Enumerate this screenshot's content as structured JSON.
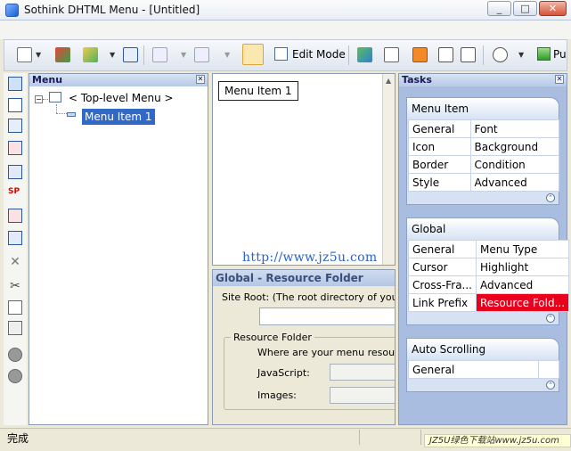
{
  "window": {
    "title": "Sothink DHTML Menu - [Untitled]"
  },
  "window_buttons": {
    "minimize": "_",
    "maximize": "□",
    "close": "✕"
  },
  "toolbar": {
    "edit_mode_label": "Edit Mode",
    "publish_label_partial": "Pu"
  },
  "menu_panel": {
    "title": "Menu",
    "tree": {
      "root_label": "< Top-level Menu >",
      "child_label": "Menu Item 1"
    }
  },
  "preview": {
    "button_label": "Menu Item 1"
  },
  "watermark": "http://www.jz5u.com",
  "resource_panel": {
    "title": "Global - Resource Folder",
    "site_root_label": "Site Root: (The root directory of your we",
    "group_title": "Resource Folder",
    "where_label": "Where are your menu resource",
    "javascript_label": "JavaScript:",
    "images_label": "Images:"
  },
  "tasks": {
    "title": "Tasks",
    "sections": [
      {
        "title": "Menu Item",
        "rows": [
          [
            "General",
            "Font"
          ],
          [
            "Icon",
            "Background"
          ],
          [
            "Border",
            "Condition"
          ],
          [
            "Style",
            "Advanced"
          ]
        ]
      },
      {
        "title": "Global",
        "rows": [
          [
            "General",
            "Menu Type"
          ],
          [
            "Cursor",
            "Highlight"
          ],
          [
            "Cross-Fra...",
            "Advanced"
          ],
          [
            "Link Prefix",
            "Resource Fold..."
          ]
        ]
      },
      {
        "title": "Auto Scrolling",
        "rows": [
          [
            "General",
            ""
          ]
        ]
      }
    ]
  },
  "status": {
    "text": "完成",
    "watermark": "JZ5U绿色下载站www.jz5u.com"
  },
  "colors": {
    "selection": "#3169c6",
    "highlight_cell": "#e8001c",
    "tasks_bg": "#a8bde0"
  }
}
